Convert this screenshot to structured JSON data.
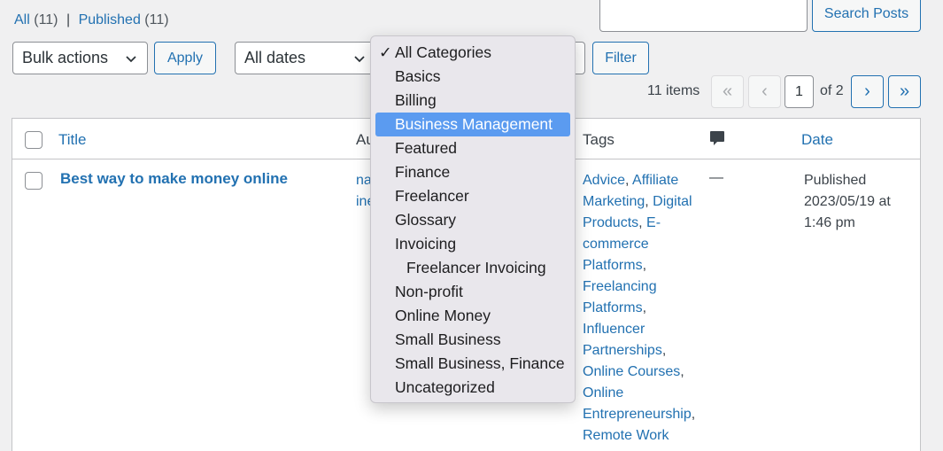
{
  "filters_links": {
    "all_label": "All",
    "all_count": "(11)",
    "separator": "|",
    "published_label": "Published",
    "published_count": "(11)"
  },
  "search": {
    "value": "",
    "button_label": "Search Posts"
  },
  "bulk_actions": {
    "selected": "Bulk actions",
    "apply_label": "Apply"
  },
  "date_filter": {
    "selected": "All dates"
  },
  "category_filter": {
    "options": [
      "All Categories",
      "Basics",
      "Billing",
      "Business Management",
      "Featured",
      "Finance",
      "Freelancer",
      "Glossary",
      "Invoicing",
      "Freelancer Invoicing",
      "Non-profit",
      "Online Money",
      "Small Business",
      "Small Business, Finance",
      "Uncategorized"
    ],
    "checked": "All Categories",
    "highlighted": "Business Management",
    "checkmark": "✓"
  },
  "filter_button_label": "Filter",
  "pagination": {
    "items_count": "11 items",
    "first": "«",
    "prev": "‹",
    "current_page": "1",
    "of_label": "of 2",
    "next": "›",
    "last": "»"
  },
  "table": {
    "columns": {
      "title": "Title",
      "author": "Au",
      "tags": "Tags",
      "comments_icon": "comment-bubble-icon",
      "date": "Date"
    },
    "rows": [
      {
        "title": "Best way to make money online",
        "author_line1": "na",
        "author_line2": "ine",
        "tags": [
          "Advice",
          "Affiliate Marketing",
          "Digital Products",
          "E-commerce Platforms",
          "Freelancing Platforms",
          "Influencer Partnerships",
          "Online Courses",
          "Online Entrepreneurship",
          "Remote Work"
        ],
        "comments": "—",
        "date_status": "Published",
        "date_line2": "2023/05/19 at",
        "date_line3": "1:46 pm"
      }
    ]
  },
  "colors": {
    "link": "#2271b1",
    "highlight": "#5b9bf0",
    "background": "#f0f0f1"
  }
}
